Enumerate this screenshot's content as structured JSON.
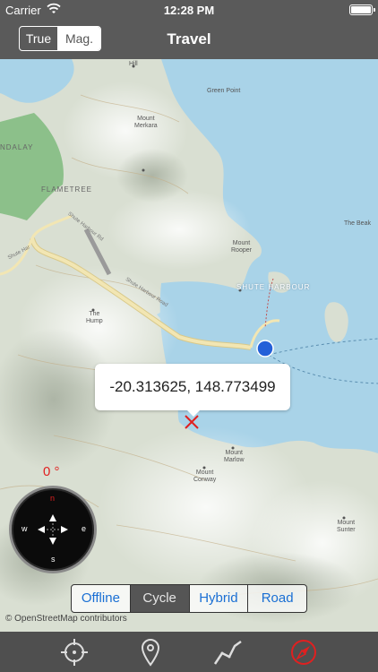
{
  "status_bar": {
    "carrier": "Carrier",
    "time": "12:28 PM"
  },
  "nav": {
    "title": "Travel",
    "north_ref": {
      "options": [
        "True",
        "Mag."
      ],
      "selected": "Mag."
    }
  },
  "map": {
    "place_labels": {
      "hill": "Hill",
      "green_point": "Green Point",
      "mount_merkara": [
        "Mount",
        "Merkara"
      ],
      "ndalay": "NDALAY",
      "flametree": "FLAMETREE",
      "shute_harbour_rd_1": "Shute Harbour Rd",
      "shute_harbour_rd_2": "Shute Harbour Road",
      "shute_har": "Shute Har",
      "the_beak": "The Beak",
      "mount_rooper": [
        "Mount",
        "Rooper"
      ],
      "shute_harbour": "SHUTE HARBOUR",
      "the_hump": [
        "The",
        "Hump"
      ],
      "mount_marlow": [
        "Mount",
        "Marlow"
      ],
      "mount_conway": [
        "Mount",
        "Conway"
      ],
      "mount_sunter": [
        "Mount",
        "Sunter"
      ]
    },
    "coordinate_callout": "-20.313625, 148.773499",
    "heading_readout": "0 °",
    "compass_labels": {
      "north": "n",
      "south": "s",
      "east": "e",
      "west": "w"
    },
    "map_types": [
      "Offline",
      "Cycle",
      "Hybrid",
      "Road"
    ],
    "selected_map_type": "Cycle",
    "attribution": "© OpenStreetMap contributors",
    "colors": {
      "water": "#a9d3e8",
      "land": "#d9dfd2",
      "forest": "#8cc08a",
      "road": "#f2e6b3",
      "marker": "#e02020",
      "location_dot": "#2460d8"
    }
  },
  "tab_bar": {
    "tabs": [
      "crosshair-icon",
      "location-pin-icon",
      "route-icon",
      "compass-icon"
    ],
    "active_tab": "compass-icon"
  }
}
